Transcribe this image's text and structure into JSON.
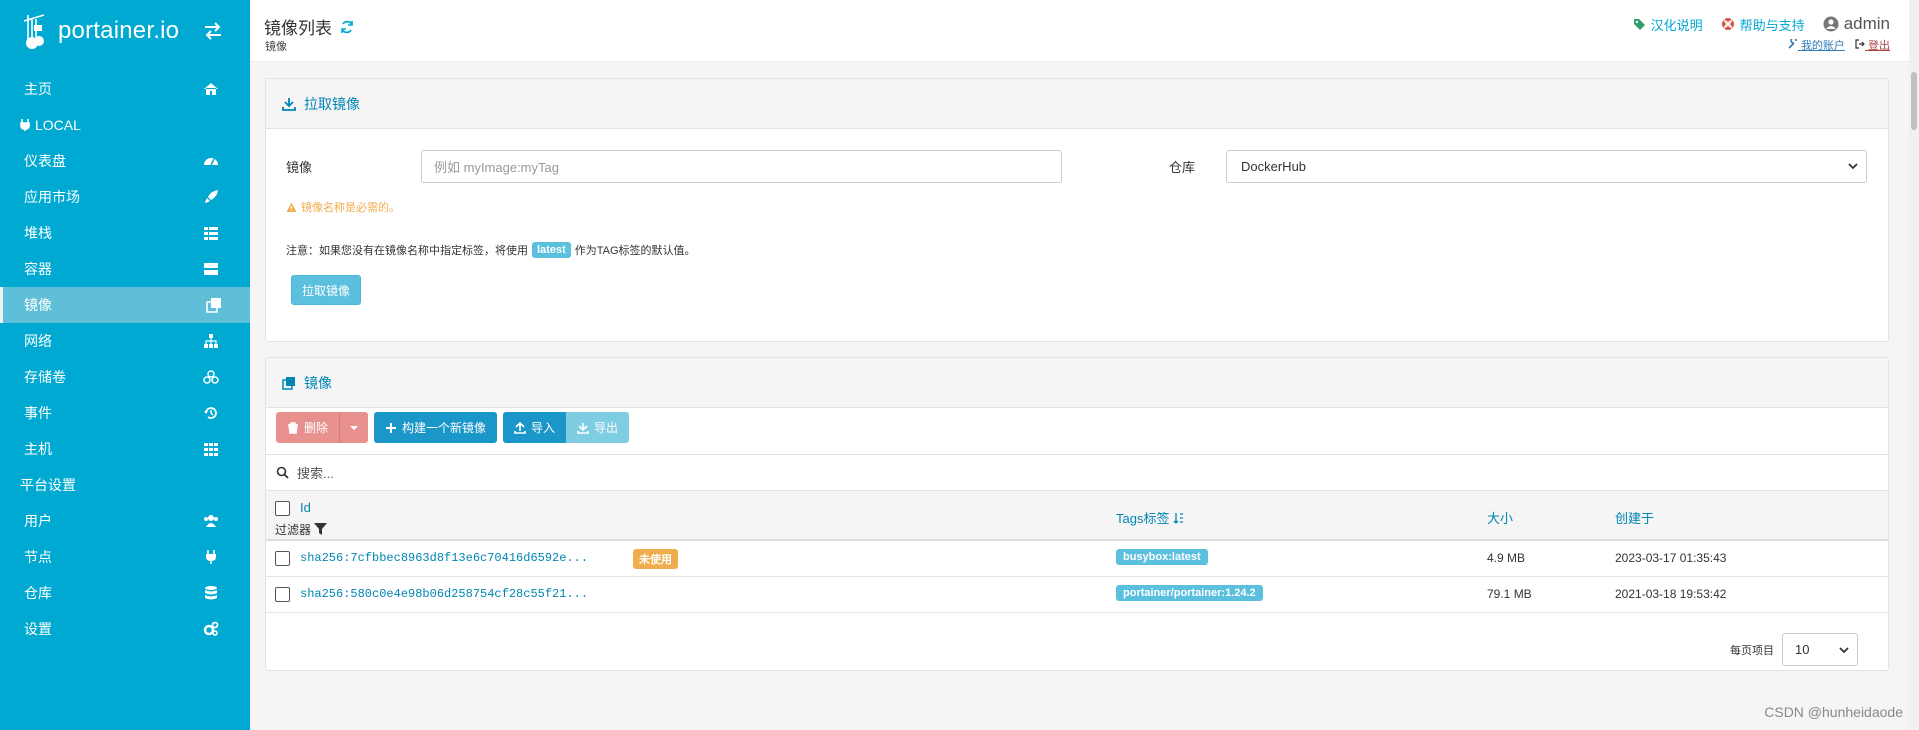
{
  "sidebar": {
    "brand": "portainer.io",
    "items": [
      {
        "label": "主页",
        "icon": "home-icon"
      },
      {
        "label": "仪表盘",
        "icon": "tachometer-icon"
      },
      {
        "label": "应用市场",
        "icon": "rocket-icon"
      },
      {
        "label": "堆栈",
        "icon": "th-list-icon"
      },
      {
        "label": "容器",
        "icon": "server-icon"
      },
      {
        "label": "镜像",
        "icon": "clone-icon"
      },
      {
        "label": "网络",
        "icon": "sitemap-icon"
      },
      {
        "label": "存储卷",
        "icon": "cubes-icon"
      },
      {
        "label": "事件",
        "icon": "history-icon"
      },
      {
        "label": "主机",
        "icon": "th-icon"
      },
      {
        "label": "用户",
        "icon": "users-icon"
      },
      {
        "label": "节点",
        "icon": "plug-icon"
      },
      {
        "label": "仓库",
        "icon": "database-icon"
      },
      {
        "label": "设置",
        "icon": "cogs-icon"
      }
    ],
    "section_local": "LOCAL",
    "section_settings": "平台设置",
    "active_color": "#5fbfd8",
    "bg_color": "#00a9d1"
  },
  "header": {
    "title": "镜像列表",
    "breadcrumb": "镜像",
    "localization_link": "汉化说明",
    "help_link": "帮助与支持",
    "user": "admin",
    "my_account": "我的账户",
    "logout": "登出"
  },
  "pull": {
    "title": "拉取镜像",
    "image_label": "镜像",
    "image_placeholder": "例如 myImage:myTag",
    "registry_label": "仓库",
    "registry_value": "DockerHub",
    "warning": "镜像名称是必需的。",
    "note_before": "注意：如果您没有在镜像名称中指定标签，将使用",
    "note_tag": "latest",
    "note_after": "作为TAG标签的默认值。",
    "button": "拉取镜像"
  },
  "images": {
    "title": "镜像",
    "buttons": {
      "delete": "删除",
      "build": "构建一个新镜像",
      "import": "导入",
      "export": "导出"
    },
    "search_placeholder": "搜索...",
    "columns": {
      "id": "Id",
      "filter": "过滤器",
      "tags": "Tags标签",
      "size": "大小",
      "created": "创建于"
    },
    "rows": [
      {
        "id": "sha256:7cfbbec8963d8f13e6c70416d6592e...",
        "unused": "未使用",
        "tag": "busybox:latest",
        "size": "4.9 MB",
        "created": "2023-03-17 01:35:43"
      },
      {
        "id": "sha256:580c0e4e98b06d258754cf28c55f21...",
        "unused": "",
        "tag": "portainer/portainer:1.24.2",
        "size": "79.1 MB",
        "created": "2021-03-18 19:53:42"
      }
    ],
    "per_page_label": "每页项目",
    "per_page_value": "10"
  },
  "watermark": "CSDN @hunheidaode"
}
